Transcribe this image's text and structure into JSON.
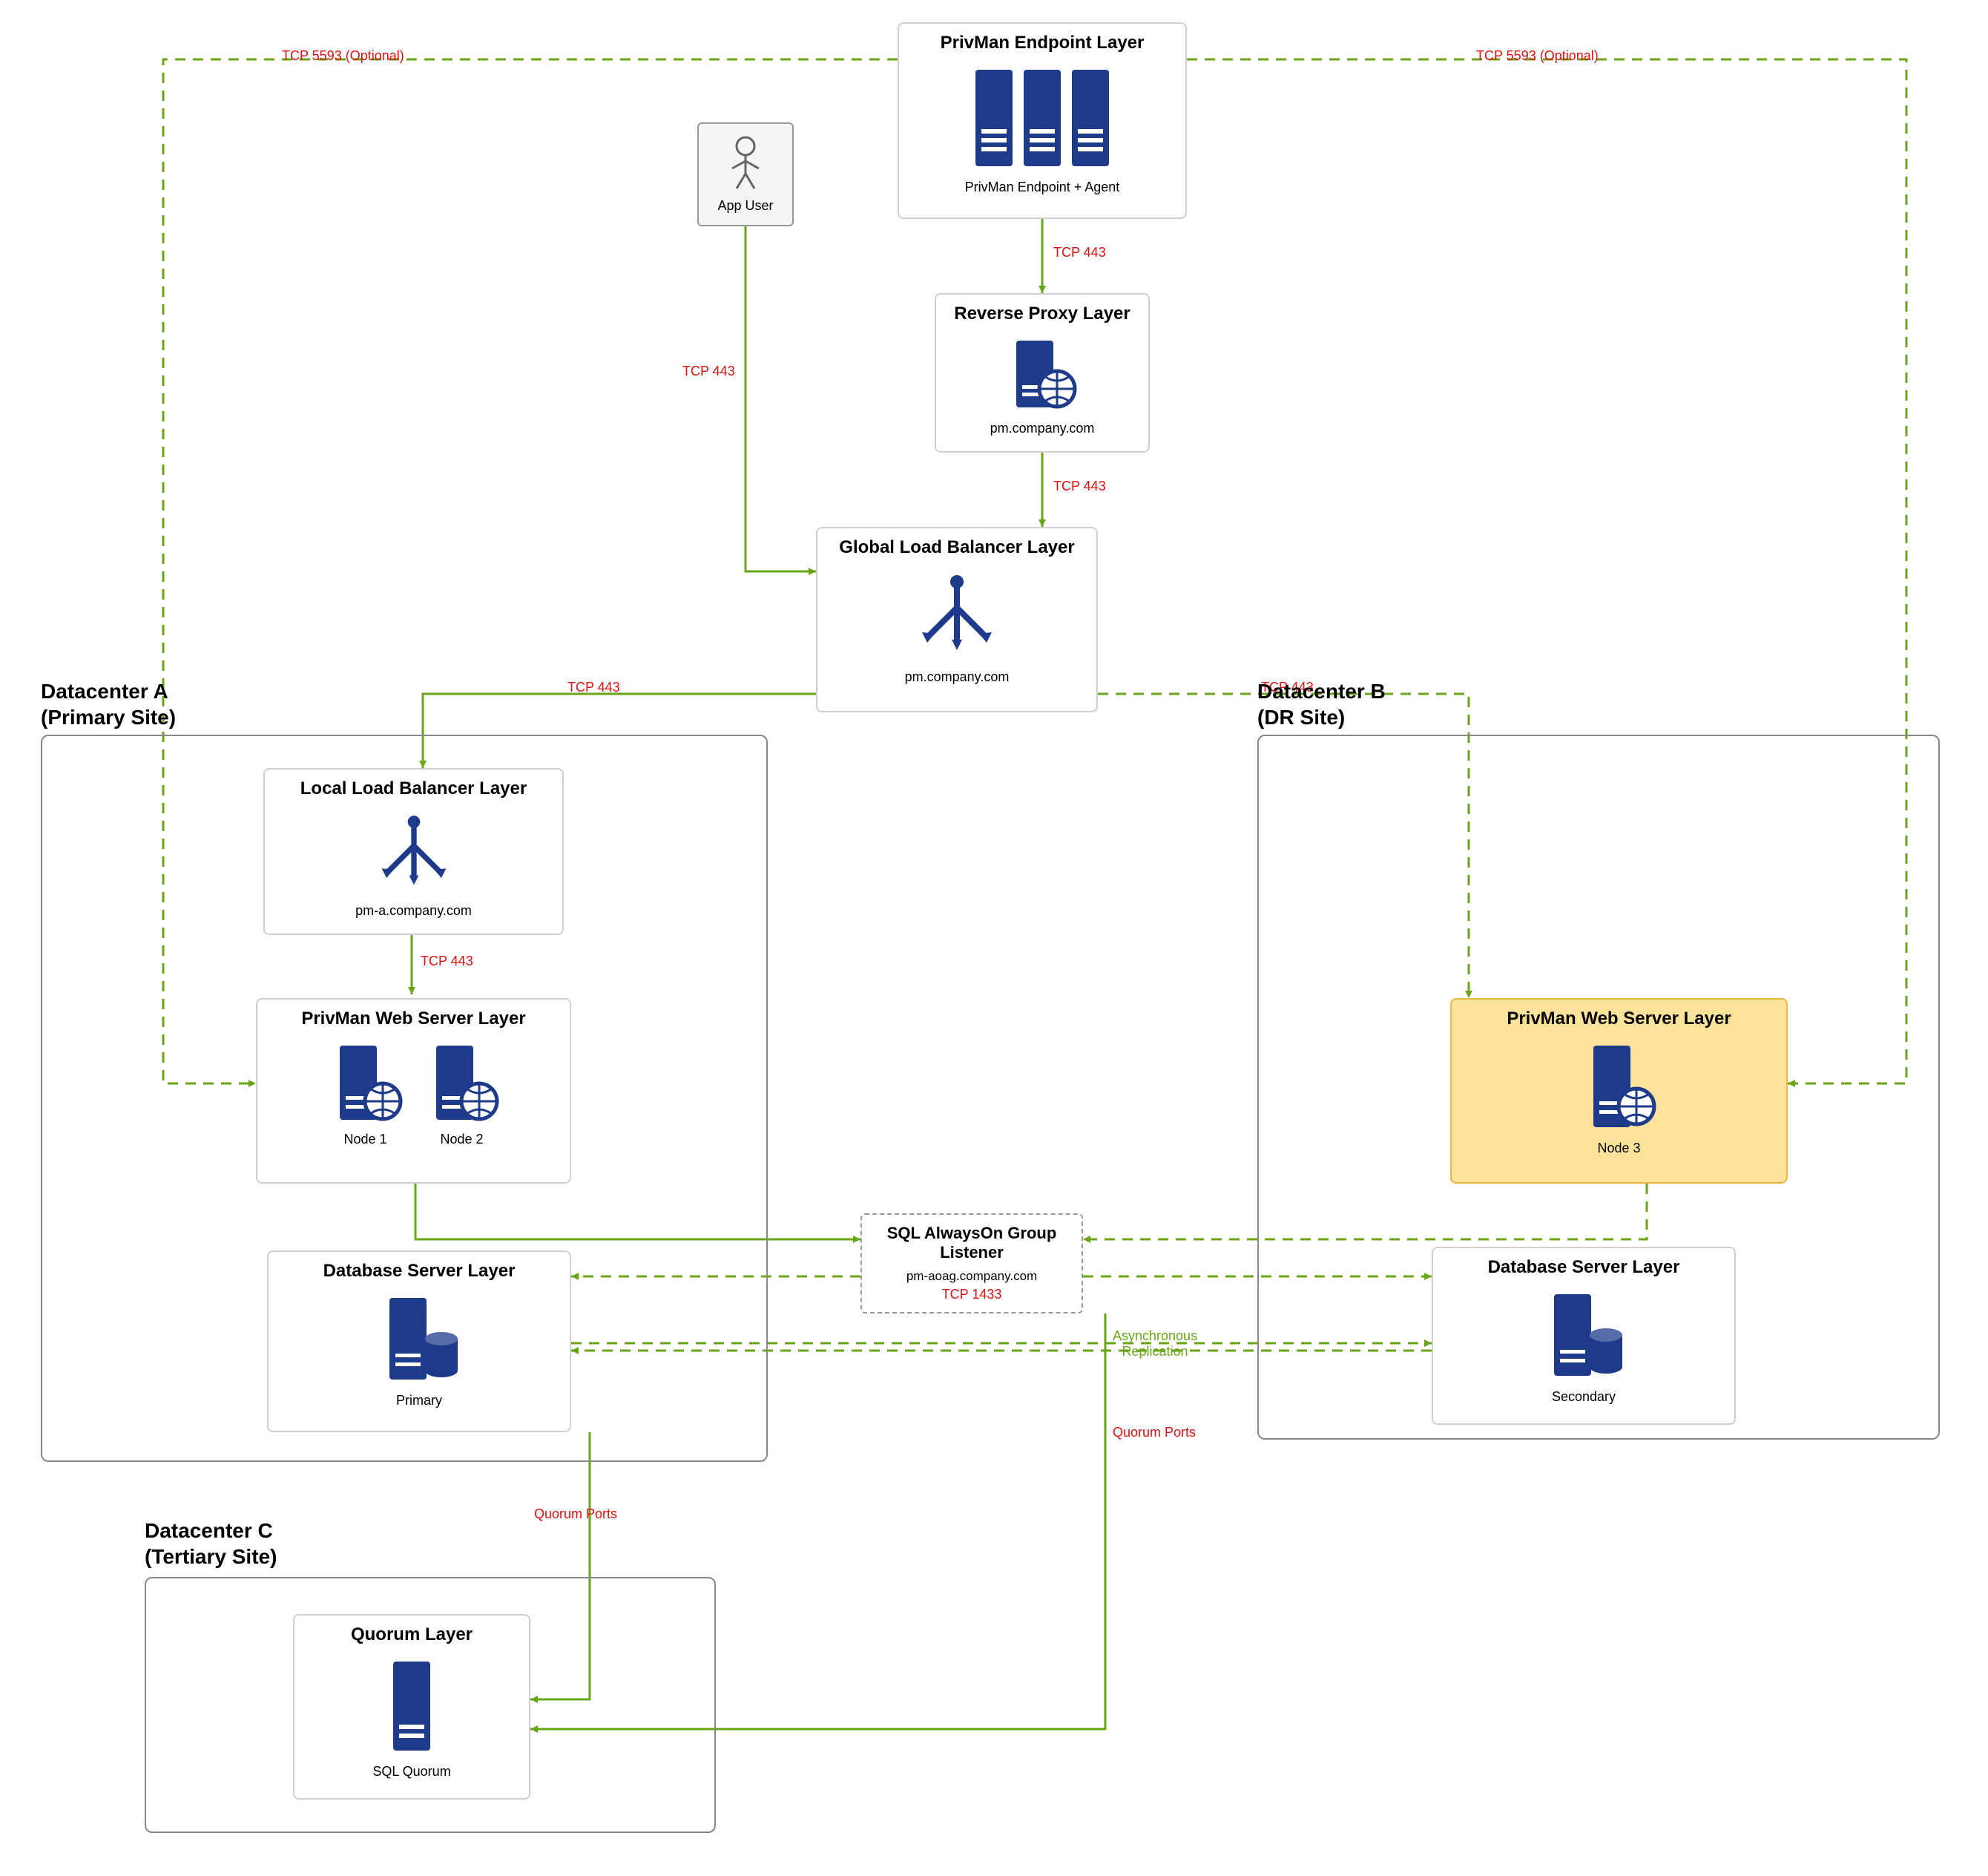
{
  "layers": {
    "endpoint": {
      "title": "PrivMan Endpoint Layer",
      "sub": "PrivMan Endpoint + Agent"
    },
    "appuser": {
      "label": "App User"
    },
    "reverseproxy": {
      "title": "Reverse Proxy Layer",
      "sub": "pm.company.com"
    },
    "glb": {
      "title": "Global Load Balancer Layer",
      "sub": "pm.company.com"
    },
    "llb": {
      "title": "Local Load Balancer Layer",
      "sub": "pm-a.company.com"
    },
    "webA": {
      "title": "PrivMan Web Server Layer",
      "n1": "Node 1",
      "n2": "Node 2"
    },
    "webB": {
      "title": "PrivMan Web Server Layer",
      "n3": "Node 3"
    },
    "listener": {
      "title": "SQL AlwaysOn Group Listener",
      "sub": "pm-aoag.company.com",
      "port": "TCP 1433"
    },
    "dbA": {
      "title": "Database Server Layer",
      "role": "Primary"
    },
    "dbB": {
      "title": "Database Server Layer",
      "role": "Secondary"
    },
    "quorum": {
      "title": "Quorum Layer",
      "role": "SQL Quorum"
    }
  },
  "datacenters": {
    "a": "Datacenter A\n(Primary Site)",
    "b": "Datacenter B\n(DR Site)",
    "c": "Datacenter C\n(Tertiary Site)"
  },
  "edges": {
    "tcp443": "TCP 443",
    "tcp5593": "TCP 5593 (Optional)",
    "tcp1433": "TCP 1433",
    "quorum": "Quorum Ports",
    "asyncrep": "Asynchronous\nReplication"
  }
}
